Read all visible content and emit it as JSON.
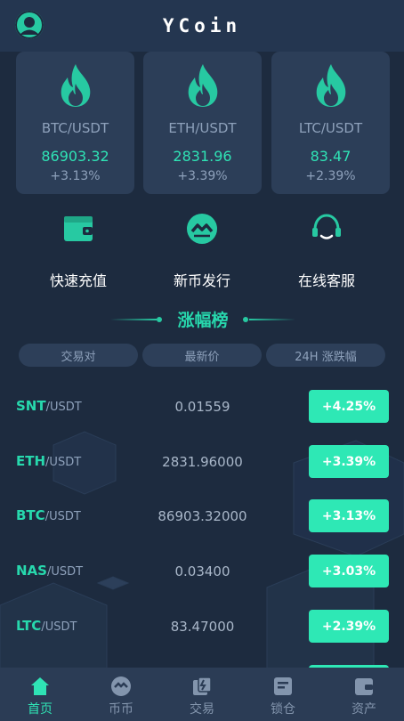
{
  "app": {
    "title": "YCoin"
  },
  "cards": [
    {
      "pair": "BTC/USDT",
      "price": "86903.32",
      "change": "+3.13%"
    },
    {
      "pair": "ETH/USDT",
      "price": "2831.96",
      "change": "+3.39%"
    },
    {
      "pair": "LTC/USDT",
      "price": "83.47",
      "change": "+2.39%"
    }
  ],
  "actions": [
    {
      "label": "快速充值",
      "icon": "wallet-icon"
    },
    {
      "label": "新币发行",
      "icon": "coin-issue-icon"
    },
    {
      "label": "在线客服",
      "icon": "headset-icon"
    }
  ],
  "section": {
    "title": "涨幅榜"
  },
  "table": {
    "headers": [
      "交易对",
      "最新价",
      "24H 涨跌幅"
    ],
    "rows": [
      {
        "base": "SNT",
        "quote": "/USDT",
        "price": "0.01559",
        "change": "+4.25%"
      },
      {
        "base": "ETH",
        "quote": "/USDT",
        "price": "2831.96000",
        "change": "+3.39%"
      },
      {
        "base": "BTC",
        "quote": "/USDT",
        "price": "86903.32000",
        "change": "+3.13%"
      },
      {
        "base": "NAS",
        "quote": "/USDT",
        "price": "0.03400",
        "change": "+3.03%"
      },
      {
        "base": "LTC",
        "quote": "/USDT",
        "price": "83.47000",
        "change": "+2.39%"
      }
    ]
  },
  "tabbar": [
    {
      "label": "首页",
      "icon": "home-icon",
      "active": true
    },
    {
      "label": "币币",
      "icon": "exchange-icon",
      "active": false
    },
    {
      "label": "交易",
      "icon": "trade-icon",
      "active": false
    },
    {
      "label": "锁仓",
      "icon": "lock-icon",
      "active": false
    },
    {
      "label": "资产",
      "icon": "wallet-icon",
      "active": false
    }
  ],
  "colors": {
    "accent": "#2fe3b5",
    "background": "#1d2b3f",
    "card": "#2c3e58",
    "badge": "#2ee8b5"
  }
}
